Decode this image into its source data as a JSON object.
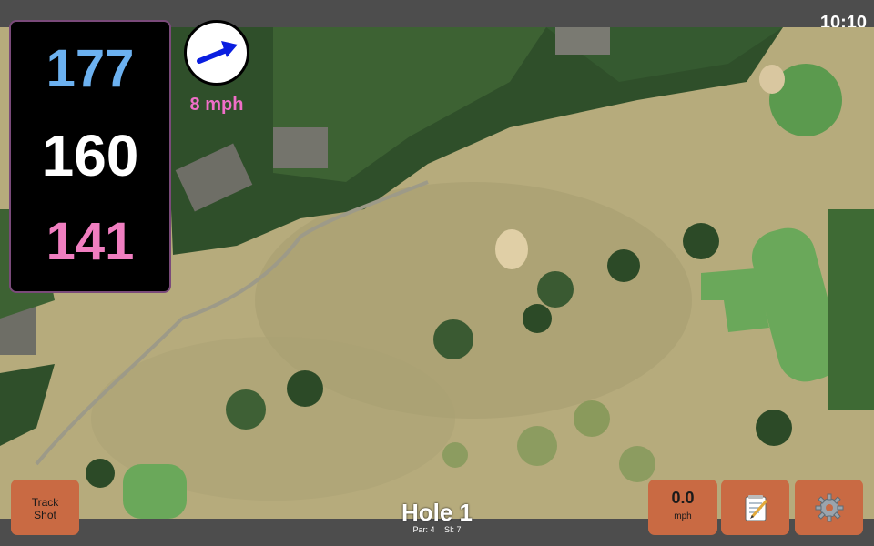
{
  "status": {
    "time": "10:10"
  },
  "distances": {
    "back": "177",
    "middle": "160",
    "front": "141"
  },
  "wind": {
    "speed": "8 mph",
    "direction_icon": "wind-arrow-icon"
  },
  "buttons": {
    "track_shot_line1": "Track",
    "track_shot_line2": "Shot",
    "speed_value": "0.0",
    "speed_unit": "mph",
    "notes_icon": "notepad-icon",
    "settings_icon": "gear-icon"
  },
  "hole": {
    "title": "Hole 1",
    "par": "Par: 4",
    "si": "SI: 7"
  },
  "colors": {
    "button": "#c96a43",
    "back_distance": "#6cb1f0",
    "middle_distance": "#ffffff",
    "front_distance": "#f07ec0",
    "wind_text": "#f06ec8"
  }
}
